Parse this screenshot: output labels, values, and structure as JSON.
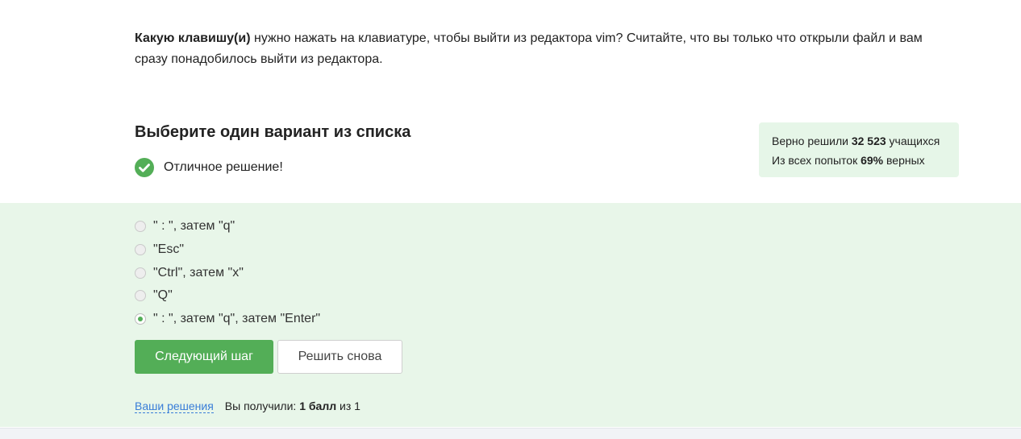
{
  "question": {
    "bold": "Какую клавишу(и)",
    "text": " нужно нажать на клавиатуре, чтобы выйти из редактора vim? Считайте, что вы только что открыли файл и вам сразу понадобилось выйти из редактора."
  },
  "choose_title": "Выберите один вариант из списка",
  "result": {
    "text": "Отличное решение!",
    "icon": "check-circle-icon",
    "color": "#53ae57"
  },
  "stats": {
    "solved_prefix": "Верно решили ",
    "solved_count": "32 523",
    "solved_suffix": " учащихся",
    "attempts_prefix": "Из всех попыток ",
    "attempts_percent": "69%",
    "attempts_suffix": " верных"
  },
  "options": [
    {
      "label": "\" : \", затем \"q\"",
      "selected": false
    },
    {
      "label": "\"Esc\"",
      "selected": false
    },
    {
      "label": "\"Ctrl\", затем \"x\"",
      "selected": false
    },
    {
      "label": "\"Q\"",
      "selected": false
    },
    {
      "label": "\" : \", затем \"q\", затем \"Enter\"",
      "selected": true
    }
  ],
  "buttons": {
    "next": "Следующий шаг",
    "retry": "Решить снова"
  },
  "footer": {
    "link": "Ваши решения",
    "score_prefix": "Вы получили: ",
    "score_value": "1 балл",
    "score_suffix": " из 1"
  },
  "colors": {
    "accent": "#53ae57",
    "answer_bg": "#e8f6e9",
    "stats_bg": "#e6f6e8",
    "link": "#3a7ed8"
  }
}
